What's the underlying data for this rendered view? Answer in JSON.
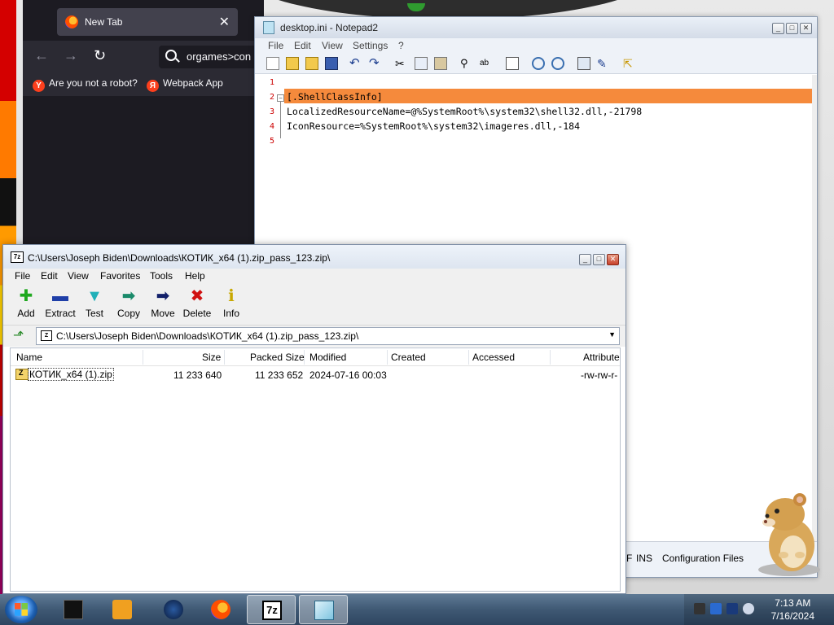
{
  "browser": {
    "tab_title": "New Tab",
    "tab_close": "✕",
    "url_text": "orgames>con",
    "bookmarks": [
      {
        "icon": "Y",
        "label": "Are you not a robot?"
      },
      {
        "icon": "Я",
        "label": "Webpack App"
      }
    ]
  },
  "notepad": {
    "title": "desktop.ini - Notepad2",
    "menu": [
      "File",
      "Edit",
      "View",
      "Settings",
      "?"
    ],
    "lines": [
      {
        "num": "1",
        "text": ""
      },
      {
        "num": "2",
        "text": "[.ShellClassInfo]"
      },
      {
        "num": "3",
        "text": "LocalizedResourceName=@%SystemRoot%\\system32\\shell32.dll,-21798"
      },
      {
        "num": "4",
        "text": "IconResource=%SystemRoot%\\system32\\imageres.dll,-184"
      },
      {
        "num": "5",
        "text": ""
      }
    ],
    "status": {
      "ins": "INS",
      "encoding": "Configuration Files",
      "partial": "F"
    },
    "highlight_color": "#f58a3c"
  },
  "sevenzip": {
    "title": "C:\\Users\\Joseph Biden\\Downloads\\КОТИК_x64 (1).zip_pass_123.zip\\",
    "menu": [
      "File",
      "Edit",
      "View",
      "Favorites",
      "Tools",
      "Help"
    ],
    "toolbar": [
      {
        "label": "Add",
        "icon": "plus-icon",
        "glyph": "✚",
        "color": "#1fa81f"
      },
      {
        "label": "Extract",
        "icon": "minus-icon",
        "glyph": "▬",
        "color": "#1f3fa8"
      },
      {
        "label": "Test",
        "icon": "check-icon",
        "glyph": "▼",
        "color": "#20b0b8"
      },
      {
        "label": "Copy",
        "icon": "copy-arrow-icon",
        "glyph": "➡",
        "color": "#1a8a6a"
      },
      {
        "label": "Move",
        "icon": "move-arrow-icon",
        "glyph": "➡",
        "color": "#12206a"
      },
      {
        "label": "Delete",
        "icon": "delete-x-icon",
        "glyph": "✖",
        "color": "#d01010"
      },
      {
        "label": "Info",
        "icon": "info-icon",
        "glyph": "ℹ",
        "color": "#c8a800"
      }
    ],
    "address": "C:\\Users\\Joseph Biden\\Downloads\\КОТИК_x64 (1).zip_pass_123.zip\\",
    "columns": [
      "Name",
      "Size",
      "Packed Size",
      "Modified",
      "Created",
      "Accessed",
      "Attribute"
    ],
    "rows": [
      {
        "name": "КОТИК_x64 (1).zip",
        "size": "11 233 640",
        "packed": "11 233 652",
        "modified": "2024-07-16 00:03",
        "created": "",
        "accessed": "",
        "attr": "-rw-rw-r-"
      }
    ]
  },
  "taskbar": {
    "items": [
      "command-window",
      "media-player",
      "globe-app",
      "firefox",
      "7zip",
      "notepad2"
    ],
    "clock_time": "7:13 AM",
    "clock_date": "7/16/2024"
  }
}
